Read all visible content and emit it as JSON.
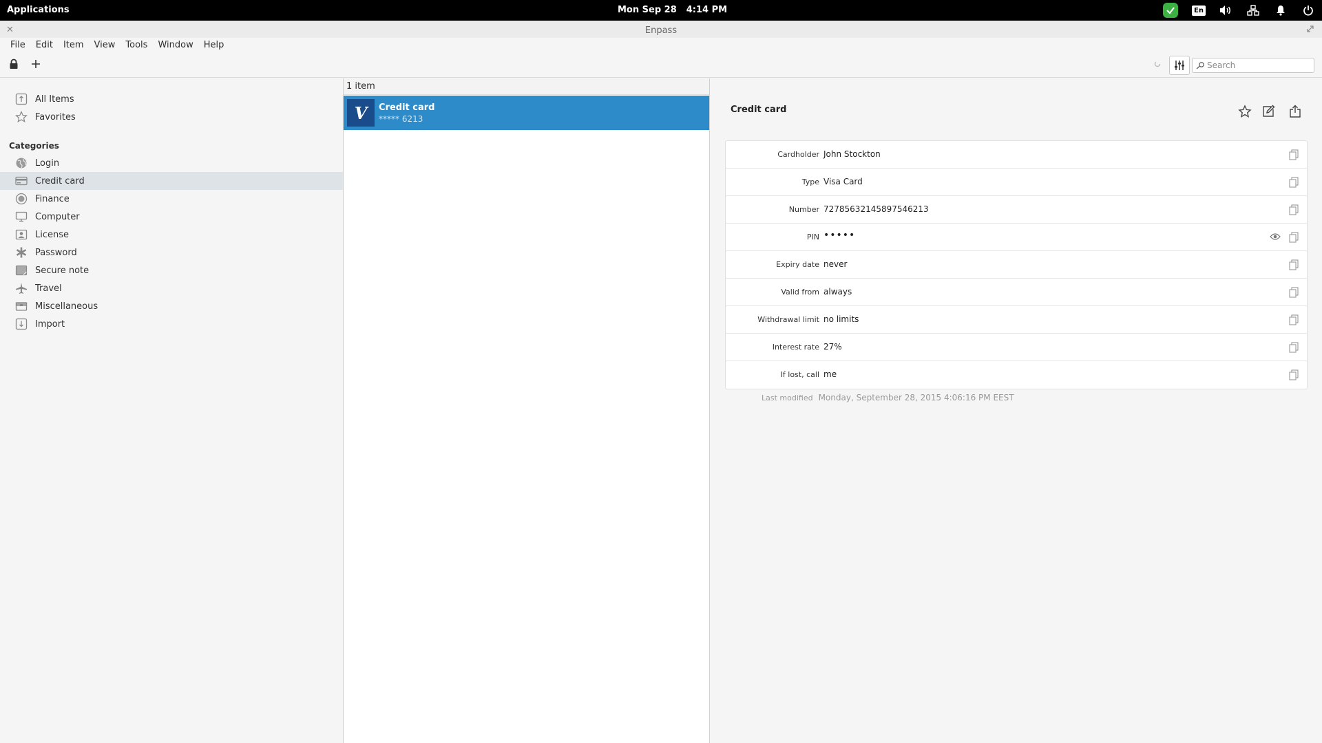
{
  "system_bar": {
    "applications": "Applications",
    "date": "Mon Sep 28",
    "time": "4:14 PM",
    "lang": "En",
    "colors": {
      "check_badge": "#3cb043"
    }
  },
  "window": {
    "title": "Enpass"
  },
  "menubar": {
    "items": [
      "File",
      "Edit",
      "Item",
      "View",
      "Tools",
      "Window",
      "Help"
    ]
  },
  "toolbar": {
    "search_placeholder": "Search"
  },
  "sidebar": {
    "top_items": [
      {
        "label": "All Items",
        "icon": "all-items-icon"
      },
      {
        "label": "Favorites",
        "icon": "star-icon"
      }
    ],
    "categories_heading": "Categories",
    "categories": [
      {
        "label": "Login",
        "icon": "globe-icon",
        "selected": false
      },
      {
        "label": "Credit card",
        "icon": "credit-card-icon",
        "selected": true
      },
      {
        "label": "Finance",
        "icon": "finance-icon",
        "selected": false
      },
      {
        "label": "Computer",
        "icon": "computer-icon",
        "selected": false
      },
      {
        "label": "License",
        "icon": "license-icon",
        "selected": false
      },
      {
        "label": "Password",
        "icon": "asterisk-icon",
        "selected": false
      },
      {
        "label": "Secure note",
        "icon": "note-icon",
        "selected": false
      },
      {
        "label": "Travel",
        "icon": "airplane-icon",
        "selected": false
      },
      {
        "label": "Miscellaneous",
        "icon": "box-icon",
        "selected": false
      },
      {
        "label": "Import",
        "icon": "import-icon",
        "selected": false
      }
    ],
    "colors": {
      "selected_bg": "#dde3e6"
    }
  },
  "list": {
    "count": "1 item",
    "items": [
      {
        "logo": "V",
        "name": "Credit card",
        "subtitle": "***** 6213",
        "selected": true
      }
    ],
    "colors": {
      "selected_bg": "#2e8bc9",
      "logo_bg": "#1a4b8a"
    }
  },
  "detail": {
    "title": "Credit card",
    "fields": [
      {
        "label": "Cardholder",
        "value": "John Stockton"
      },
      {
        "label": "Type",
        "value": "Visa Card"
      },
      {
        "label": "Number",
        "value": "72785632145897546213"
      },
      {
        "label": "PIN",
        "value": "•••••",
        "secret": true
      },
      {
        "label": "Expiry date",
        "value": "never"
      },
      {
        "label": "Valid from",
        "value": "always"
      },
      {
        "label": "Withdrawal limit",
        "value": "no limits"
      },
      {
        "label": "Interest rate",
        "value": "27%"
      },
      {
        "label": "If lost, call",
        "value": "me"
      }
    ],
    "last_modified_label": "Last modified",
    "last_modified_value": "Monday, September 28, 2015 4:06:16 PM EEST"
  }
}
